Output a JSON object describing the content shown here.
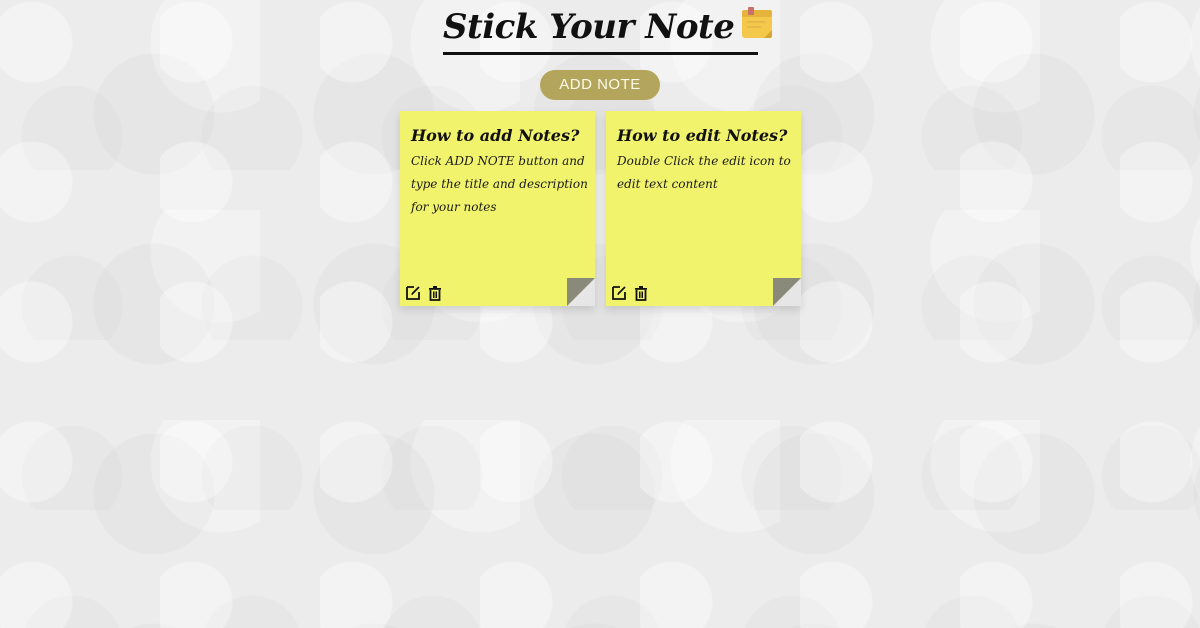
{
  "header": {
    "title": "Stick Your Note",
    "title_icon": "sticky-note-emoji-icon"
  },
  "toolbar": {
    "add_note_label": "ADD NOTE"
  },
  "notes": [
    {
      "title": "How to add Notes?",
      "description": "Click ADD NOTE button and type the title and description for your notes",
      "edit_icon": "edit-icon",
      "delete_icon": "trash-icon"
    },
    {
      "title": "How to edit Notes?",
      "description": "Double Click the edit icon to edit text content",
      "edit_icon": "edit-icon",
      "delete_icon": "trash-icon"
    }
  ],
  "colors": {
    "background": "#ececec",
    "note": "#f2f36c",
    "button": "#b3a55c",
    "button_text": "#fdfbea",
    "text": "#111111"
  }
}
